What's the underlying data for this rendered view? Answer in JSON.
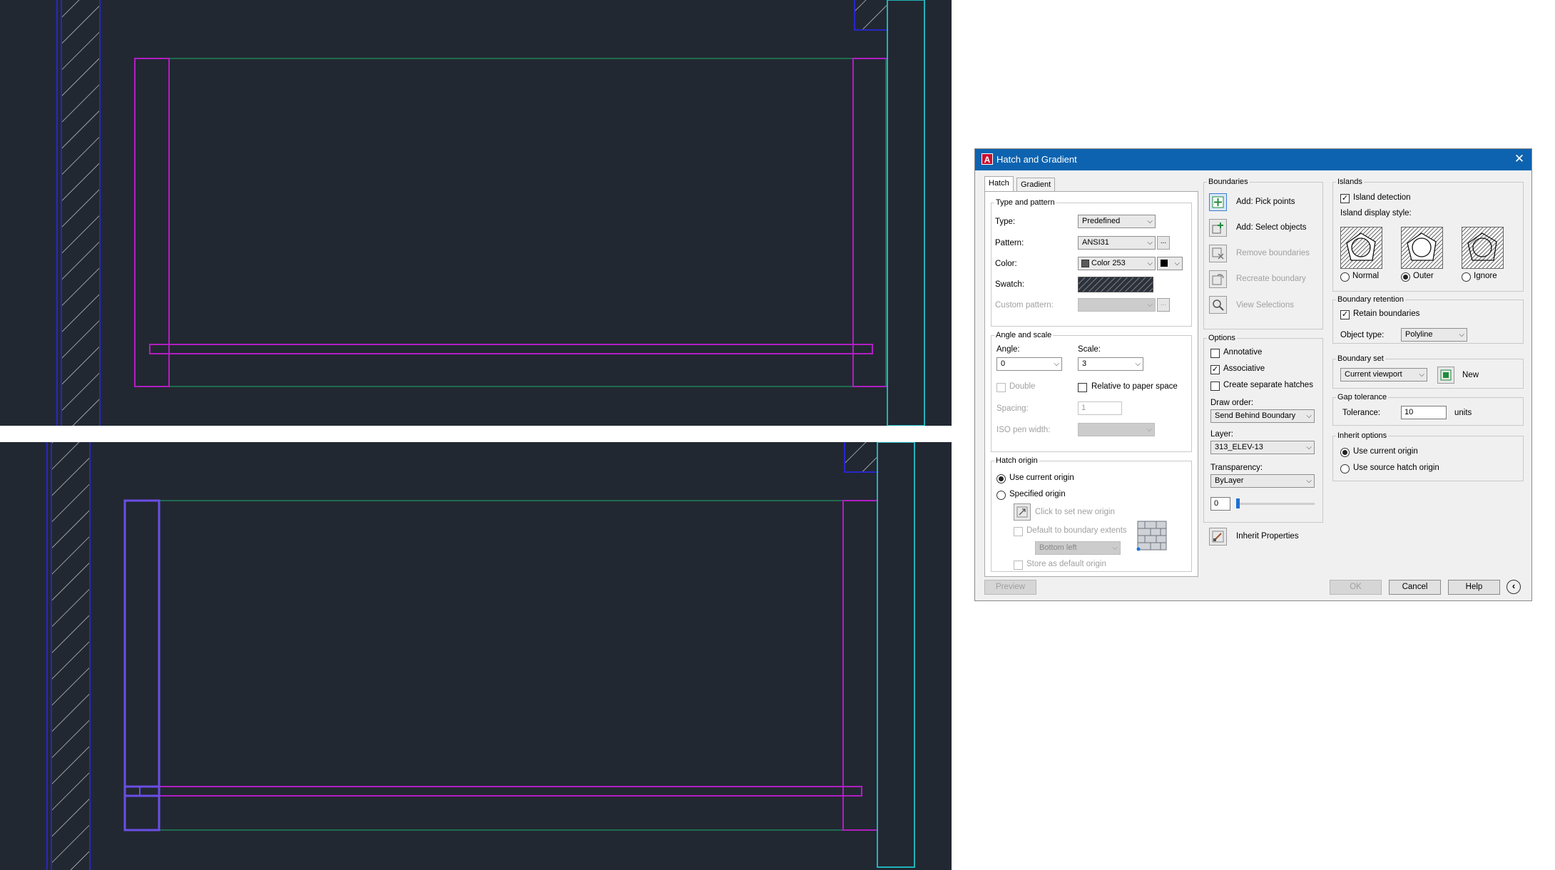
{
  "dialog": {
    "title": "Hatch and Gradient",
    "tabs": [
      "Hatch",
      "Gradient"
    ],
    "type_pattern": {
      "legend": "Type and pattern",
      "type_label": "Type:",
      "type_value": "Predefined",
      "pattern_label": "Pattern:",
      "pattern_value": "ANSI31",
      "pattern_browse": "...",
      "color_label": "Color:",
      "color_value": "Color 253",
      "swatch_label": "Swatch:",
      "custom_pattern_label": "Custom pattern:",
      "custom_browse": "..."
    },
    "angle_scale": {
      "legend": "Angle and scale",
      "angle_label": "Angle:",
      "angle_value": "0",
      "scale_label": "Scale:",
      "scale_value": "3",
      "double_label": "Double",
      "relative_label": "Relative to paper space",
      "spacing_label": "Spacing:",
      "spacing_value": "1",
      "iso_label": "ISO pen width:"
    },
    "hatch_origin": {
      "legend": "Hatch origin",
      "use_current": "Use current origin",
      "specified": "Specified origin",
      "click_new": "Click to set new origin",
      "default_extents": "Default to boundary extents",
      "extents_value": "Bottom left",
      "store_default": "Store as default origin"
    },
    "boundaries": {
      "legend": "Boundaries",
      "pick_points": "Add: Pick points",
      "select_objects": "Add: Select objects",
      "remove": "Remove boundaries",
      "recreate": "Recreate boundary",
      "view": "View Selections"
    },
    "options": {
      "legend": "Options",
      "annotative": "Annotative",
      "associative": "Associative",
      "separate": "Create separate hatches",
      "draw_order_label": "Draw order:",
      "draw_order_value": "Send Behind Boundary",
      "layer_label": "Layer:",
      "layer_value": "313_ELEV-13",
      "transparency_label": "Transparency:",
      "transparency_value": "ByLayer",
      "transparency_amount": "0"
    },
    "inherit_properties": "Inherit Properties",
    "islands": {
      "legend": "Islands",
      "detection": "Island detection",
      "style_label": "Island display style:",
      "normal": "Normal",
      "outer": "Outer",
      "ignore": "Ignore"
    },
    "boundary_retention": {
      "legend": "Boundary retention",
      "retain": "Retain boundaries",
      "object_type_label": "Object type:",
      "object_type_value": "Polyline"
    },
    "boundary_set": {
      "legend": "Boundary set",
      "value": "Current viewport",
      "new_label": "New"
    },
    "gap_tolerance": {
      "legend": "Gap tolerance",
      "tolerance_label": "Tolerance:",
      "tolerance_value": "10",
      "units": "units"
    },
    "inherit_options": {
      "legend": "Inherit options",
      "use_current": "Use current origin",
      "use_source": "Use source hatch origin"
    },
    "footer": {
      "preview": "Preview",
      "ok": "OK",
      "cancel": "Cancel",
      "help": "Help"
    }
  },
  "colors": {
    "canvas": "#222831",
    "magenta": "#b21dc4",
    "green": "#1f6b4e",
    "cyan": "#20b3bc",
    "blue": "#2626c9",
    "highlight": "#6a4ee6",
    "title_bar": "#0d63b0"
  }
}
